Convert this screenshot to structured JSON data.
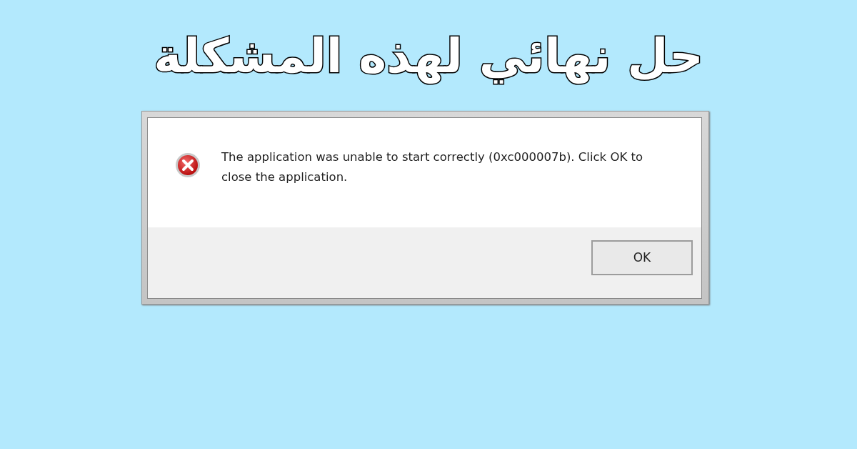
{
  "headline": "حل نهائي لهذه المشكلة",
  "dialog": {
    "kind": "error",
    "message": "The application was unable to start correctly (0xc000007b). Click OK to close the application.",
    "buttons": [
      "OK"
    ]
  }
}
